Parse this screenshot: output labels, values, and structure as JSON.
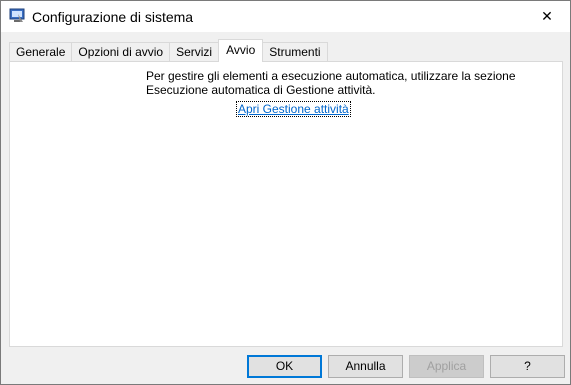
{
  "window": {
    "title": "Configurazione di sistema",
    "close_glyph": "✕",
    "icon": "msconfig-icon"
  },
  "tabs": [
    {
      "label": "Generale",
      "active": false
    },
    {
      "label": "Opzioni di avvio",
      "active": false
    },
    {
      "label": "Servizi",
      "active": false
    },
    {
      "label": "Avvio",
      "active": true
    },
    {
      "label": "Strumenti",
      "active": false
    }
  ],
  "startup": {
    "message_line1": "Per gestire gli elementi a esecuzione automatica, utilizzare la sezione",
    "message_line2": "Esecuzione automatica di Gestione attività.",
    "link": "Apri Gestione attività"
  },
  "buttons": {
    "ok": "OK",
    "cancel": "Annulla",
    "apply": "Applica",
    "help": "?"
  },
  "colors": {
    "accent": "#0078d7",
    "link": "#0066cc"
  }
}
